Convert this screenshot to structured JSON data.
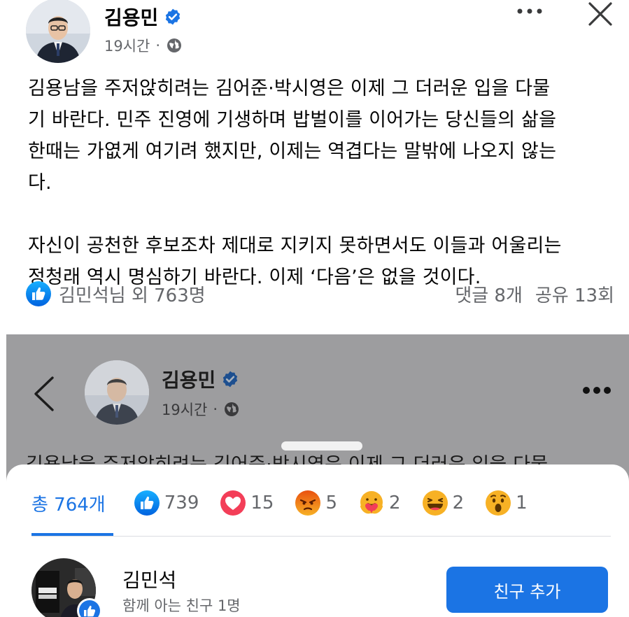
{
  "post": {
    "author": "김용민",
    "time": "19시간",
    "dot": "·",
    "paragraphs": [
      [
        "김용남을 주저앉히려는 김어준·박시영은 이제 그 더러운 입을 다물",
        "기 바란다. 민주 진영에 기생하며 밥벌이를 이어가는 당신들의 삶을",
        "한때는 가엾게 여기려 했지만, 이제는 역겹다는 말밖에 나오지 않는",
        "다."
      ],
      [
        "자신이 공천한 후보조차 제대로 지키지 못하면서도 이들과 어울리는",
        "정청래 역시 명심하기 바란다. 이제 ‘다음’은 없을 것이다."
      ]
    ],
    "likers": "김민석님 외 763명",
    "comments": "댓글 8개",
    "shares": "공유 13회"
  },
  "viewer": {
    "author": "김용민",
    "time": "19시간",
    "dot": "·",
    "peek_text": "김용남을 주저앉히려는 김어준·박시영은 이제 그 더러운 입을 다물"
  },
  "reactions_sheet": {
    "total_label": "총 764개",
    "tabs": [
      {
        "icon": "like-icon",
        "count": "739"
      },
      {
        "icon": "love-icon",
        "count": "15"
      },
      {
        "icon": "angry-icon",
        "count": "5"
      },
      {
        "icon": "care-icon",
        "count": "2"
      },
      {
        "icon": "haha-icon",
        "count": "2"
      },
      {
        "icon": "wow-icon",
        "count": "1"
      }
    ],
    "person": {
      "name": "김민석",
      "mutual": "함께 아는 친구 1명",
      "button": "친구 추가"
    }
  },
  "colors": {
    "facebook_blue": "#1b74e4",
    "secondary_text": "#65676b",
    "dim_overlay": "#9d9d9f",
    "love_red": "#f33e58",
    "angry_orange": "#e9710f",
    "haha_yellow": "#f7b125"
  }
}
